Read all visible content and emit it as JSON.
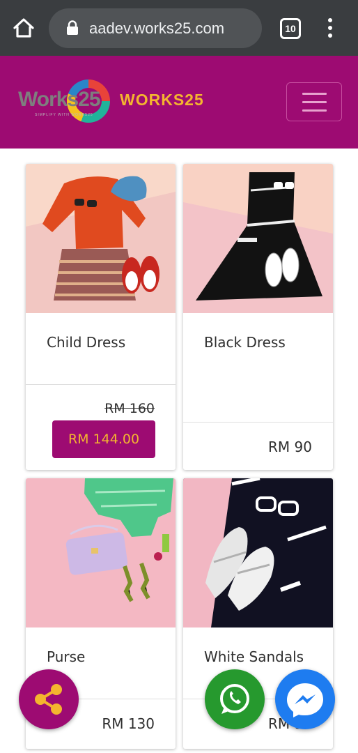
{
  "browser": {
    "url": "aadev.works25.com",
    "tab_count": "10"
  },
  "header": {
    "logo_text": "Works25",
    "logo_tagline": "SIMPLIFY WITH WORKS25",
    "brand_name": "WORKS25"
  },
  "products": [
    {
      "name": "Child Dress",
      "old_price": "RM 160",
      "price": "RM 144.00"
    },
    {
      "name": "Black Dress",
      "price": "RM 90"
    },
    {
      "name": "Purse",
      "price": "RM 130"
    },
    {
      "name": "White Sandals",
      "price": "RM 90"
    }
  ],
  "colors": {
    "brand_primary": "#9d0b72",
    "brand_accent": "#f4b52f",
    "whatsapp": "#26992e",
    "messenger": "#1e7cf0"
  },
  "icons": {
    "share": "share-icon",
    "whatsapp": "whatsapp-icon",
    "messenger": "messenger-icon"
  }
}
